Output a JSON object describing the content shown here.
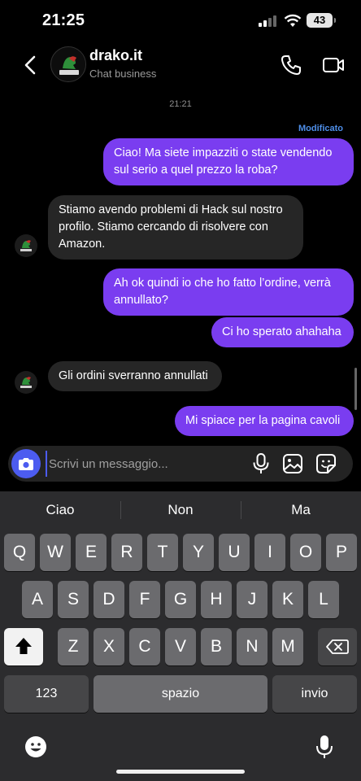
{
  "status_bar": {
    "time": "21:25",
    "battery": "43"
  },
  "header": {
    "name": "drako.it",
    "subtitle": "Chat business",
    "avatar_text": "Drako.it"
  },
  "chat": {
    "timestamp": "21:21",
    "edited_label": "Modificato",
    "messages": [
      {
        "from": "me",
        "text": "Ciao! Ma siete impazziti o state vendendo sul serio a quel prezzo la roba?"
      },
      {
        "from": "them",
        "text": "Stiamo avendo problemi di Hack sul nostro profilo. Stiamo cercando di risolvere con Amazon."
      },
      {
        "from": "me",
        "text": "Ah ok quindi io che ho fatto l’ordine, verrà annullato?"
      },
      {
        "from": "me",
        "text": "Ci ho sperato ahahaha"
      },
      {
        "from": "them",
        "text": "Gli ordini sverranno annullati"
      },
      {
        "from": "me",
        "text": "Mi spiace per la pagina cavoli"
      }
    ]
  },
  "composer": {
    "placeholder": "Scrivi un messaggio..."
  },
  "keyboard": {
    "suggestions": [
      "Ciao",
      "Non",
      "Ma"
    ],
    "row1": [
      "Q",
      "W",
      "E",
      "R",
      "T",
      "Y",
      "U",
      "I",
      "O",
      "P"
    ],
    "row2": [
      "A",
      "S",
      "D",
      "F",
      "G",
      "H",
      "J",
      "K",
      "L"
    ],
    "row3": [
      "Z",
      "X",
      "C",
      "V",
      "B",
      "N",
      "M"
    ],
    "numbers_label": "123",
    "space_label": "spazio",
    "return_label": "invio"
  },
  "colors": {
    "sent_bubble": "#7a3df0",
    "received_bubble": "#262626",
    "accent": "#4c5cf0",
    "edited": "#4e8ee8"
  },
  "icons": [
    "back-icon",
    "phone-icon",
    "video-icon",
    "camera-icon",
    "mic-icon",
    "gallery-icon",
    "sticker-icon",
    "shift-icon",
    "backspace-icon",
    "emoji-icon",
    "dictation-icon"
  ]
}
